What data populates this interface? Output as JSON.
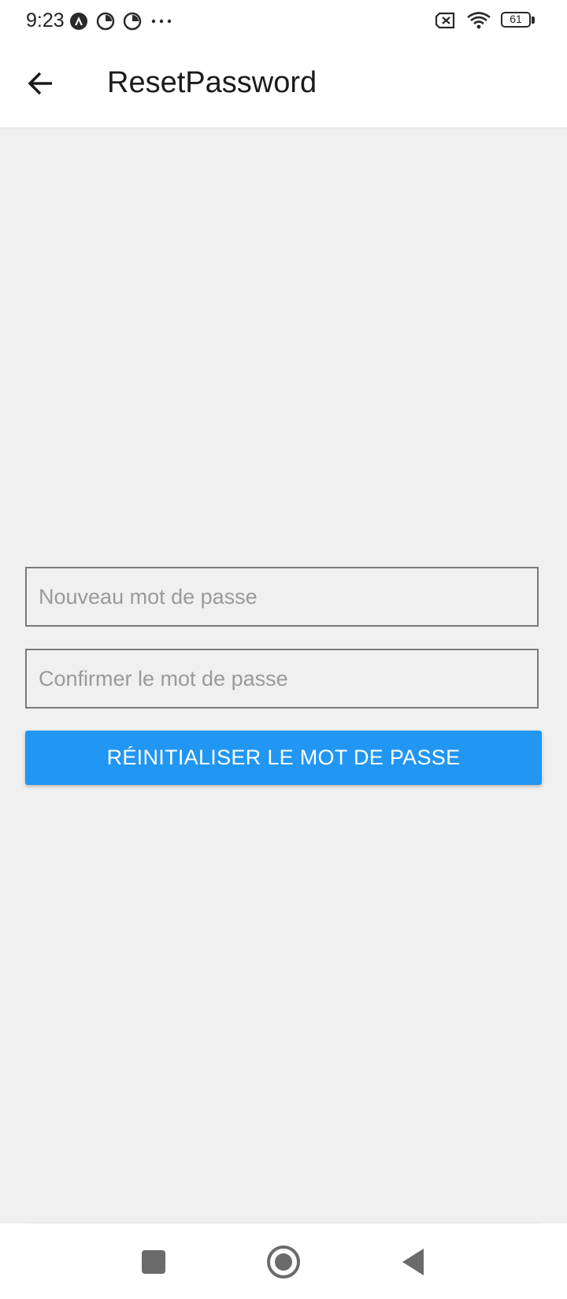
{
  "status_bar": {
    "time": "9:23",
    "battery": "61",
    "left_icons": [
      "android-auto-icon",
      "app-notification-icon",
      "app-notification-icon",
      "more-dots-icon"
    ],
    "right_icons": [
      "no-sim-icon",
      "wifi-icon",
      "battery-icon"
    ]
  },
  "app_bar": {
    "title": "ResetPassword",
    "back_icon": "arrow-left-icon"
  },
  "form": {
    "new_password": {
      "placeholder": "Nouveau mot de passe",
      "value": ""
    },
    "confirm_password": {
      "placeholder": "Confirmer le mot de passe",
      "value": ""
    },
    "submit_label": "RÉINITIALISER LE MOT DE PASSE"
  },
  "nav_bar": {
    "buttons": [
      "recents-square-icon",
      "home-circle-icon",
      "back-triangle-icon"
    ]
  },
  "colors": {
    "accent": "#2196f3",
    "background": "#f0f0f0",
    "surface": "#ffffff"
  }
}
